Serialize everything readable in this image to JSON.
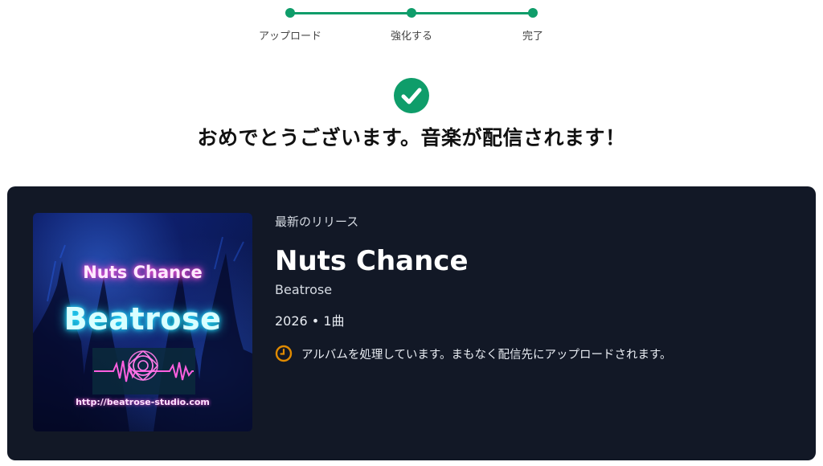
{
  "stepper": {
    "steps": [
      {
        "label": "アップロード",
        "state": "complete"
      },
      {
        "label": "強化する",
        "state": "complete"
      },
      {
        "label": "完了",
        "state": "complete"
      }
    ],
    "color": "#0f9d6a"
  },
  "success": {
    "icon": "check-circle-icon",
    "headline": "おめでとうございます。音楽が配信されます！"
  },
  "release": {
    "eyebrow": "最新のリリース",
    "title": "Nuts Chance",
    "artist": "Beatrose",
    "meta": "2026 • 1曲",
    "status_icon": "clock-icon",
    "status_color": "#e08a00",
    "status_text": "アルバムを処理しています。まもなく配信先にアップロードされます。",
    "cover": {
      "title": "Nuts Chance",
      "artist": "Beatrose",
      "url": "http://beatrose-studio.com"
    }
  }
}
